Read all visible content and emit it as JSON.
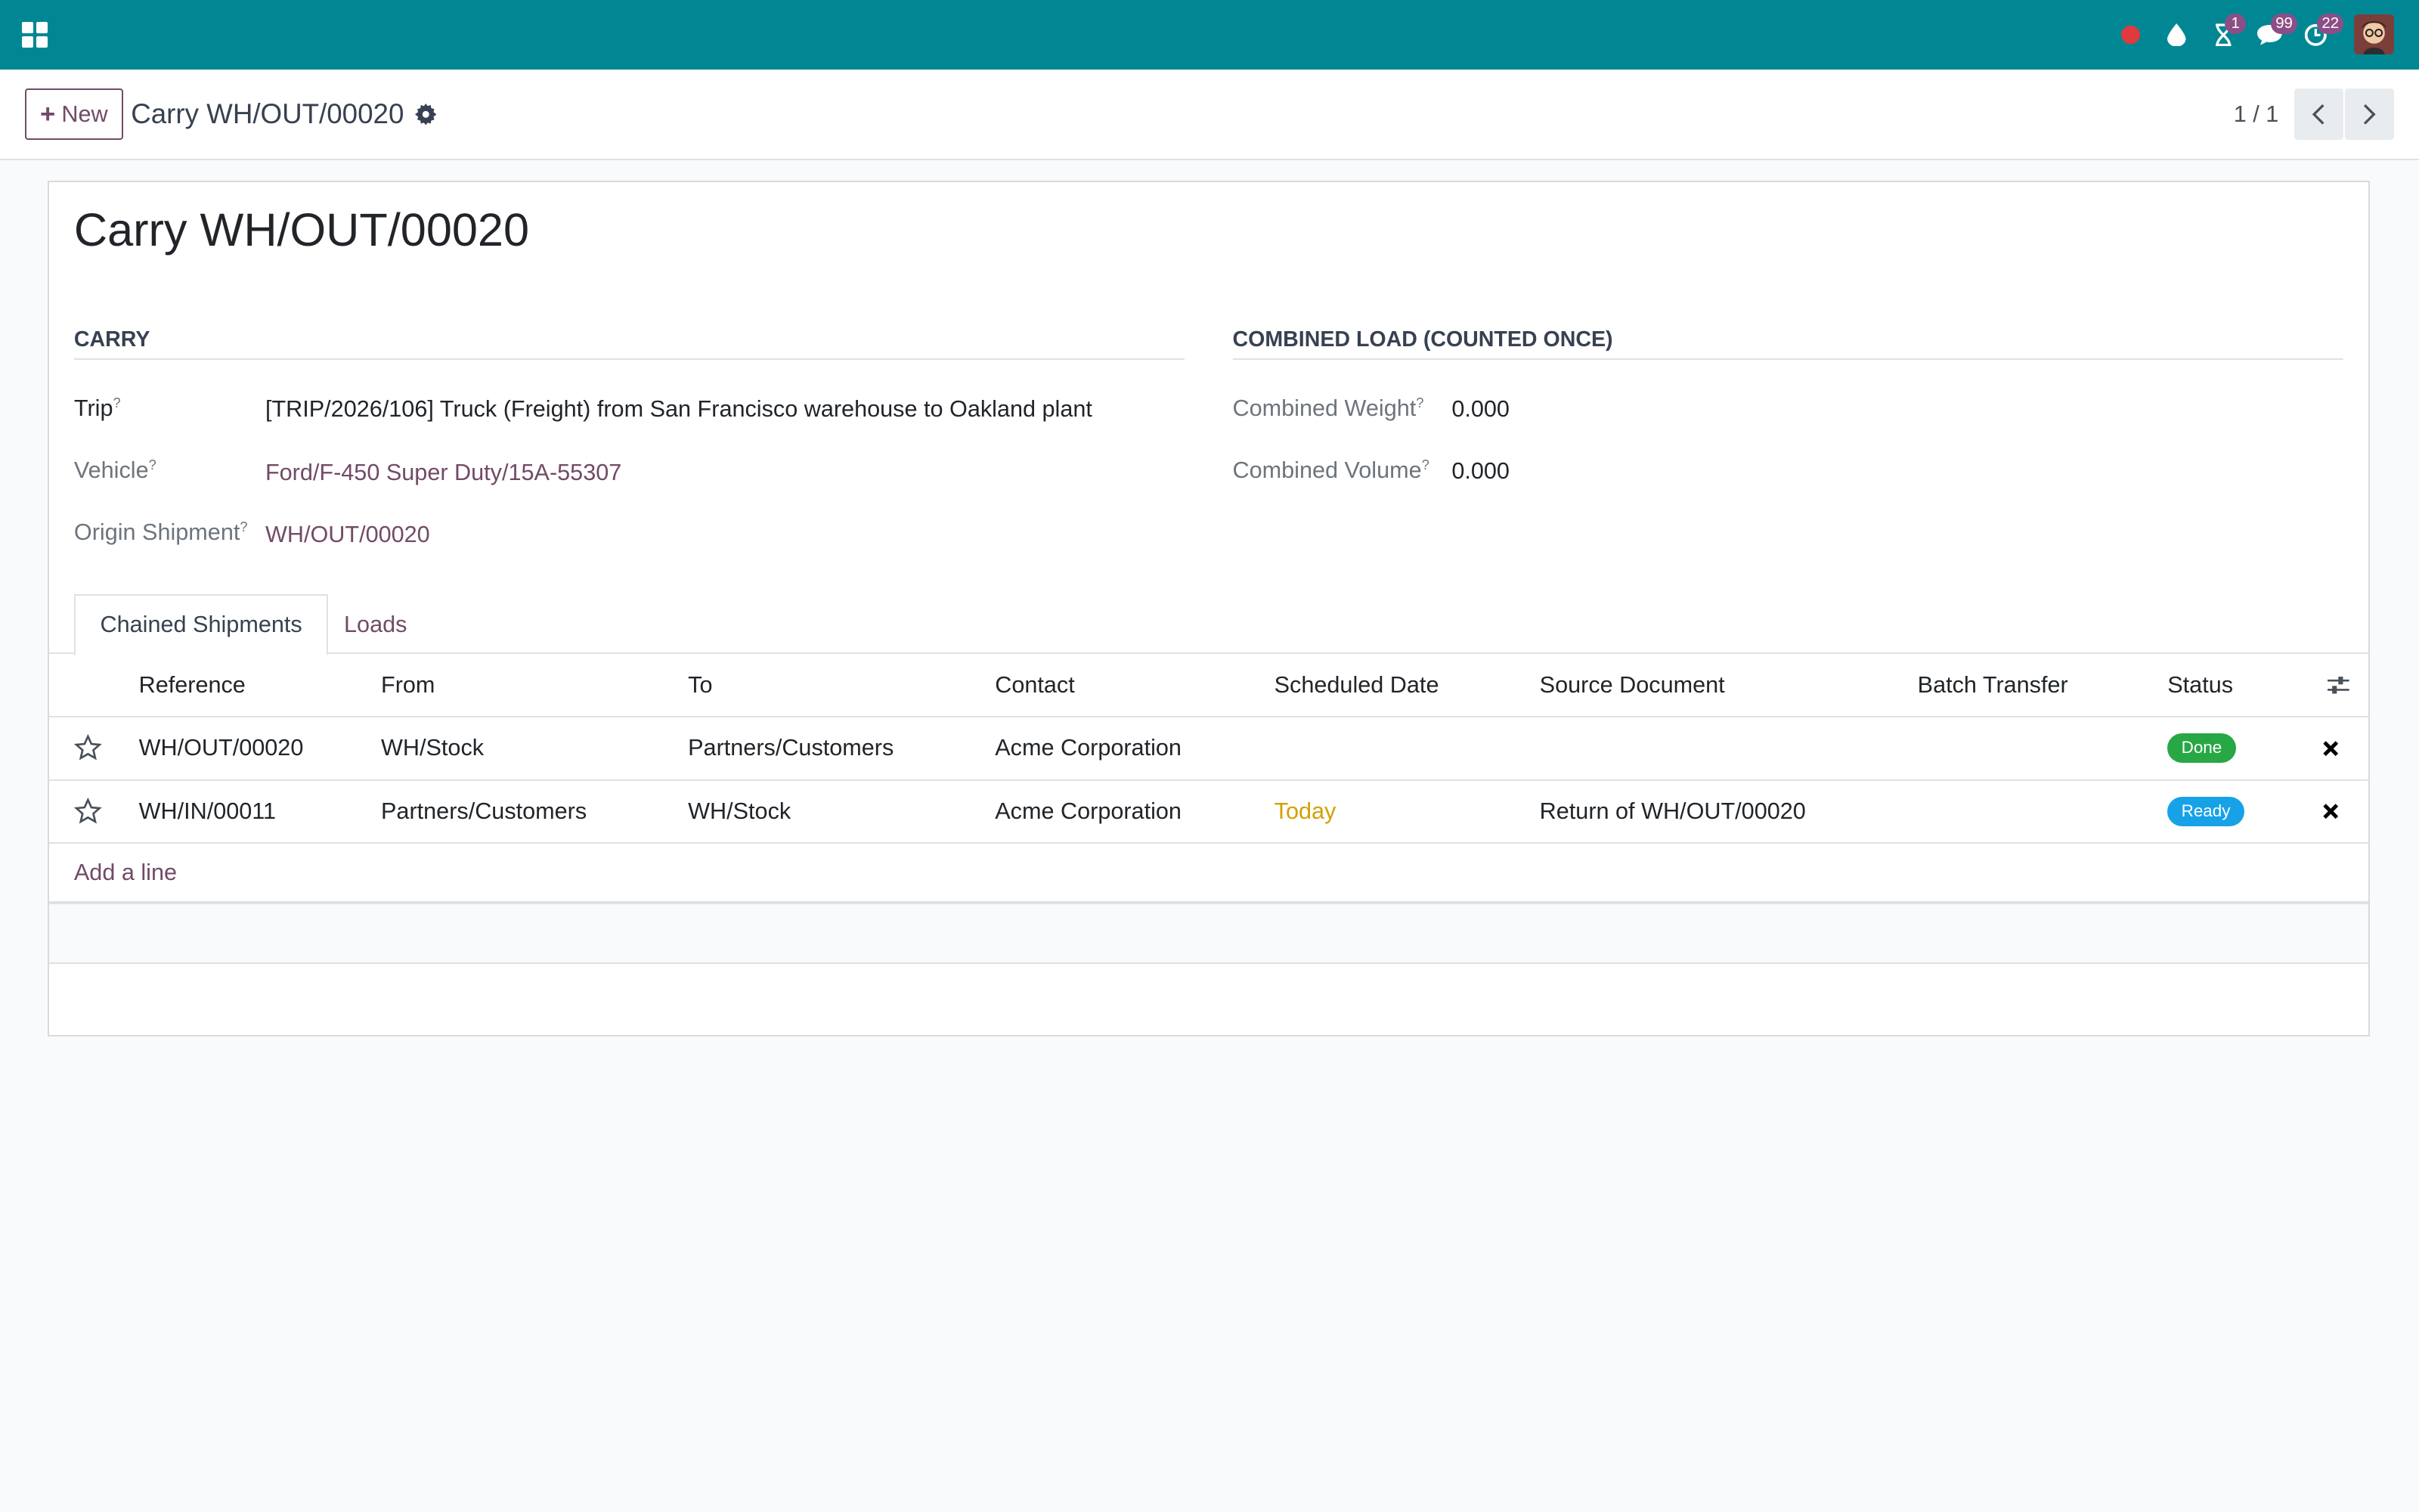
{
  "systray": {
    "activity_badge": "1",
    "messages_badge": "99",
    "timer_badge": "22"
  },
  "control": {
    "new_label": "New",
    "breadcrumb": "Carry WH/OUT/00020",
    "pager": "1 / 1"
  },
  "form": {
    "title": "Carry WH/OUT/00020",
    "carry": {
      "section_title": "CARRY",
      "trip_label": "Trip",
      "trip_value": "[TRIP/2026/106] Truck (Freight) from San Francisco warehouse to Oakland plant",
      "vehicle_label": "Vehicle",
      "vehicle_value": "Ford/F-450 Super Duty/15A-55307",
      "origin_label": "Origin Shipment",
      "origin_value": "WH/OUT/00020",
      "help_mark": "?"
    },
    "combined": {
      "section_title": "COMBINED LOAD (COUNTED ONCE)",
      "weight_label": "Combined Weight",
      "weight_value": "0.000",
      "volume_label": "Combined Volume",
      "volume_value": "0.000"
    }
  },
  "tabs": {
    "chained": "Chained Shipments",
    "loads": "Loads"
  },
  "table": {
    "headers": {
      "reference": "Reference",
      "from": "From",
      "to": "To",
      "contact": "Contact",
      "scheduled_date": "Scheduled Date",
      "source_document": "Source Document",
      "batch_transfer": "Batch Transfer",
      "status": "Status"
    },
    "rows": [
      {
        "reference": "WH/OUT/00020",
        "from": "WH/Stock",
        "to": "Partners/Customers",
        "contact": "Acme Corporation",
        "scheduled_date": "",
        "source_document": "",
        "batch_transfer": "",
        "status": "Done"
      },
      {
        "reference": "WH/IN/00011",
        "from": "Partners/Customers",
        "to": "WH/Stock",
        "contact": "Acme Corporation",
        "scheduled_date": "Today",
        "source_document": "Return of WH/OUT/00020",
        "batch_transfer": "",
        "status": "Ready"
      }
    ],
    "add_line": "Add a line"
  },
  "colors": {
    "navbar": "#018794",
    "brand": "#714b67",
    "done": "#28a745",
    "ready": "#17a2e8",
    "today": "#d3a100"
  }
}
